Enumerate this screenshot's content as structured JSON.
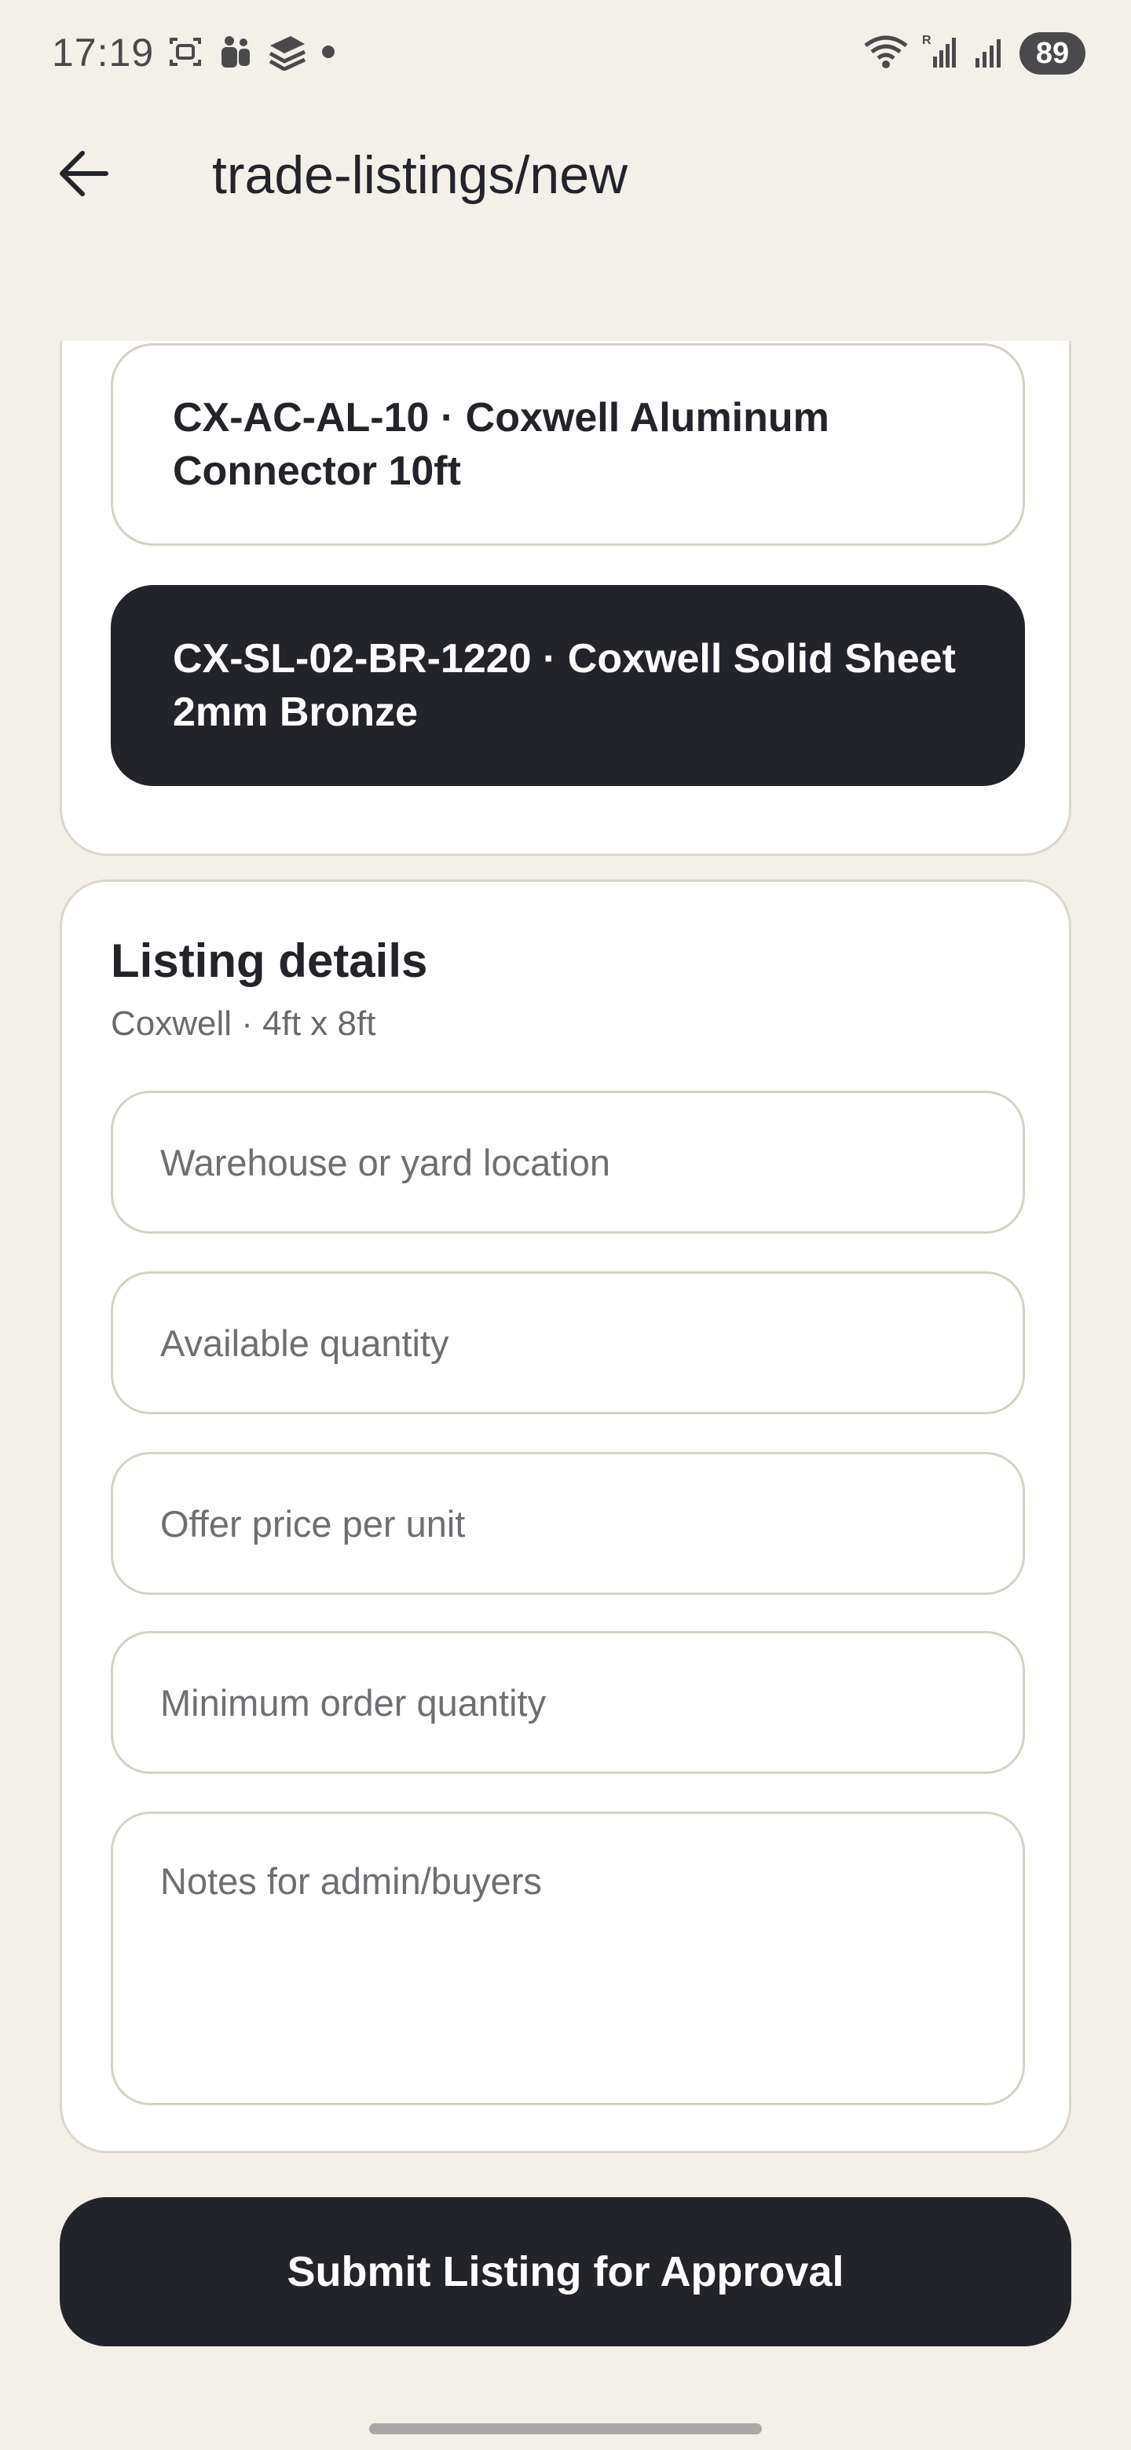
{
  "status_bar": {
    "time": "17:19",
    "battery": "89",
    "icons_left": [
      "screenshot-icon",
      "people-icon",
      "layers-icon",
      "dot-icon"
    ],
    "icons_right": [
      "wifi-icon",
      "signal-roaming-icon",
      "signal-icon",
      "battery-icon"
    ]
  },
  "app_bar": {
    "back_icon": "arrow-left-icon",
    "title": "trade-listings/new"
  },
  "product_options": [
    {
      "label": "CX-AC-AL-10 · Coxwell Aluminum Connector 10ft",
      "selected": false
    },
    {
      "label": "CX-SL-02-BR-1220 · Coxwell Solid Sheet 2mm Bronze",
      "selected": true
    }
  ],
  "listing_details": {
    "title": "Listing details",
    "subtitle": "Coxwell · 4ft x 8ft",
    "fields": {
      "location": {
        "placeholder": "Warehouse or yard location",
        "value": ""
      },
      "quantity": {
        "placeholder": "Available quantity",
        "value": ""
      },
      "price": {
        "placeholder": "Offer price per unit",
        "value": ""
      },
      "min_order": {
        "placeholder": "Minimum order quantity",
        "value": ""
      },
      "notes": {
        "placeholder": "Notes for admin/buyers",
        "value": ""
      }
    }
  },
  "submit": {
    "label": "Submit Listing for Approval"
  },
  "colors": {
    "background": "#f3f0ea",
    "card": "#ffffff",
    "border": "#dcd7cc",
    "dark": "#23242a",
    "muted_text": "#6a6a6e"
  }
}
